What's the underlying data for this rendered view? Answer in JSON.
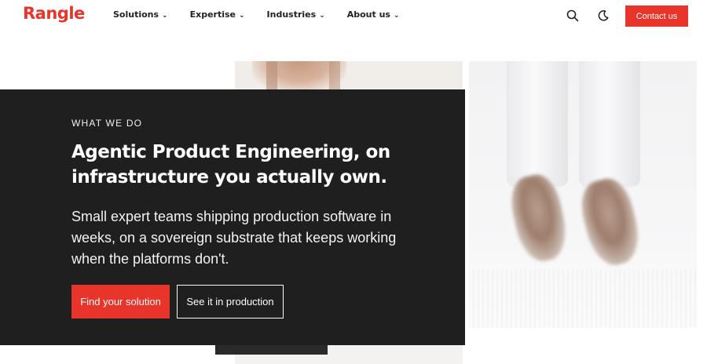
{
  "header": {
    "logo": "Rangle",
    "nav": [
      {
        "label": "Solutions",
        "chevron": "⌄"
      },
      {
        "label": "Expertise",
        "chevron": "⌄"
      },
      {
        "label": "Industries",
        "chevron": "⌄"
      },
      {
        "label": "About us",
        "chevron": "⌄"
      }
    ],
    "search_icon": "search-icon",
    "theme_icon": "moon-icon",
    "contact_label": "Contact us"
  },
  "hero": {
    "eyebrow": "WHAT WE DO",
    "headline": "Agentic Product Engineering, on infrastructure you actually own.",
    "body": "Small expert teams shipping production software in weeks, on a sovereign substrate that keeps working when the platforms don't.",
    "primary_cta": "Find your solution",
    "secondary_cta": "See it in production"
  },
  "colors": {
    "brand_red": "#e8342a",
    "panel_dark": "#1f1f1f",
    "text_dark": "#222222"
  }
}
